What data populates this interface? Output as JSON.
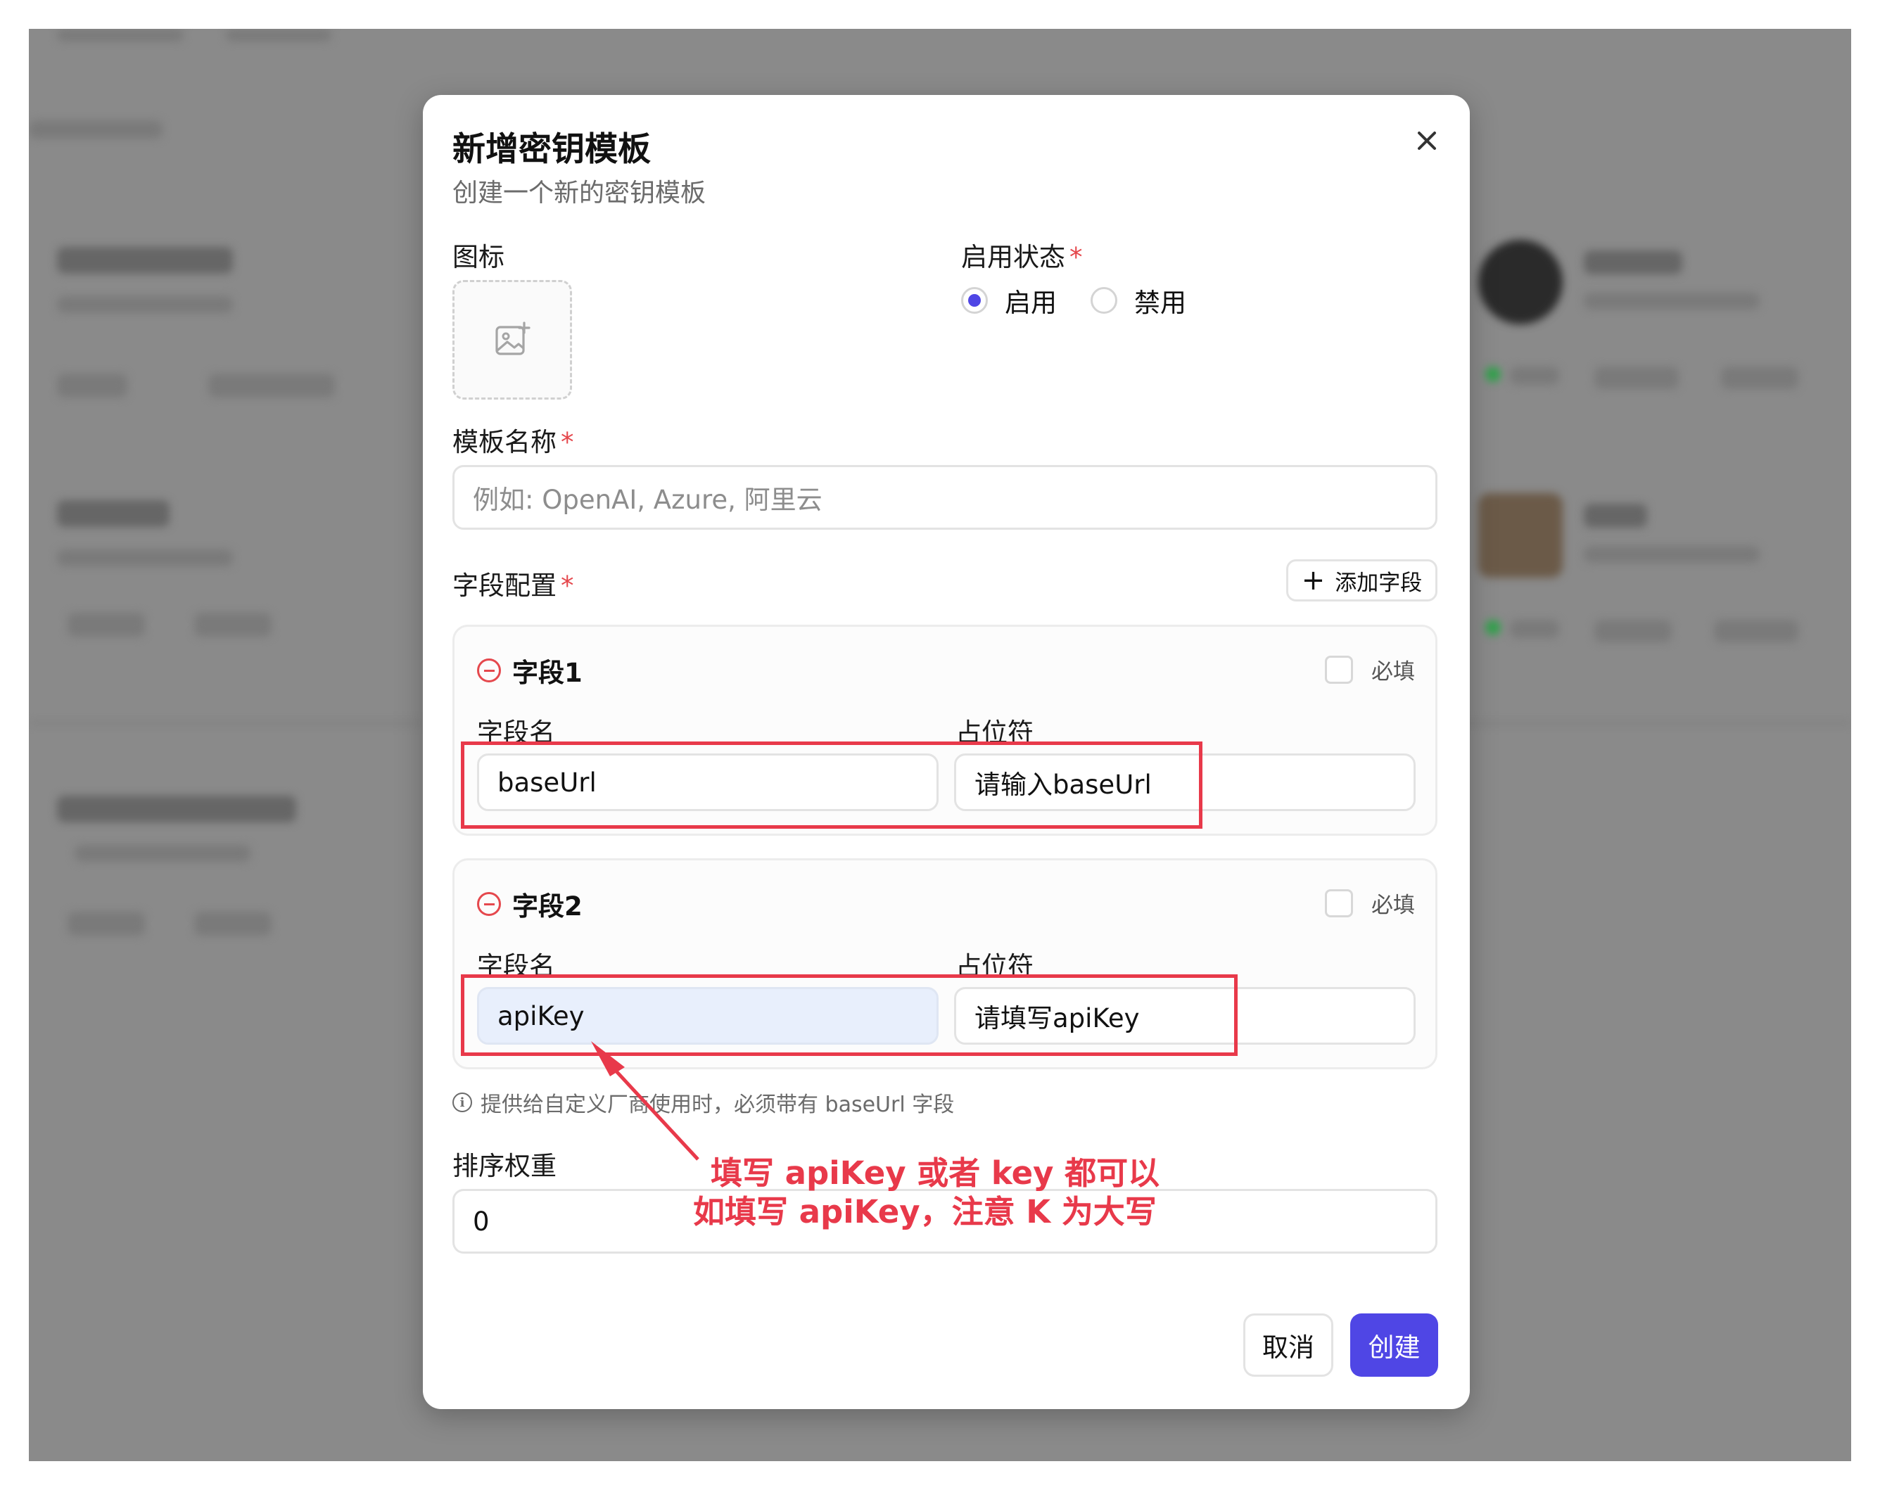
{
  "dialog": {
    "title": "新增密钥模板",
    "subtitle": "创建一个新的密钥模板",
    "icon_label": "图标",
    "status_label": "启用状态",
    "status_options": [
      {
        "label": "启用",
        "selected": true
      },
      {
        "label": "禁用",
        "selected": false
      }
    ],
    "name_label": "模板名称",
    "name_placeholder": "例如: OpenAI, Azure, 阿里云",
    "fields_label": "字段配置",
    "add_field_label": "添加字段",
    "fields": [
      {
        "title": "字段1",
        "required_label": "必填",
        "name_label": "字段名",
        "name_value": "baseUrl",
        "placeholder_label": "占位符",
        "placeholder_value": "请输入baseUrl"
      },
      {
        "title": "字段2",
        "required_label": "必填",
        "name_label": "字段名",
        "name_value": "apiKey",
        "placeholder_label": "占位符",
        "placeholder_value": "请填写apiKey"
      }
    ],
    "hint": "提供给自定义厂商使用时，必须带有 baseUrl 字段",
    "sort_label": "排序权重",
    "sort_value": "0",
    "cancel_label": "取消",
    "create_label": "创建",
    "required_mark": "*"
  },
  "annotation": {
    "line1": "填写 apiKey 或者 key 都可以",
    "line2": "如填写 apiKey，注意 K 为大写"
  },
  "colors": {
    "accent": "#4f46e5",
    "annotation": "#e8394a",
    "required": "#e5484d",
    "overlay": "#8a8a8a"
  }
}
